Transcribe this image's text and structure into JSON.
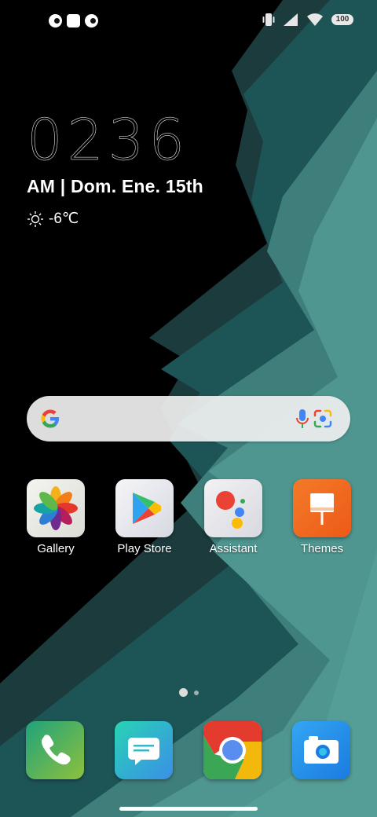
{
  "status_bar": {
    "battery_level": "100",
    "icons": [
      "notification-icon",
      "notification-icon",
      "notification-icon",
      "vibrate-icon",
      "signal-icon",
      "wifi-icon",
      "battery-icon"
    ]
  },
  "clock_widget": {
    "time": "0236",
    "date": "AM | Dom. Ene. 15th",
    "weather_icon": "sun-icon",
    "temperature": "-6℃"
  },
  "search_bar": {
    "icons": [
      "google-g-icon",
      "microphone-icon",
      "lens-icon"
    ]
  },
  "apps": [
    {
      "label": "Gallery",
      "icon": "gallery-icon"
    },
    {
      "label": "Play Store",
      "icon": "play-store-icon"
    },
    {
      "label": "Assistant",
      "icon": "assistant-icon"
    },
    {
      "label": "Themes",
      "icon": "themes-icon"
    }
  ],
  "pager": {
    "pages": 2,
    "current": 1
  },
  "dock": [
    {
      "icon": "phone-icon"
    },
    {
      "icon": "messages-icon"
    },
    {
      "icon": "chrome-icon"
    },
    {
      "icon": "camera-icon"
    }
  ],
  "colors": {
    "wallpaper_dark": "#1b3a3c",
    "wallpaper_mid": "#1e5a5c",
    "wallpaper_light": "#4f9690",
    "themes_orange": "#f26d1f"
  }
}
